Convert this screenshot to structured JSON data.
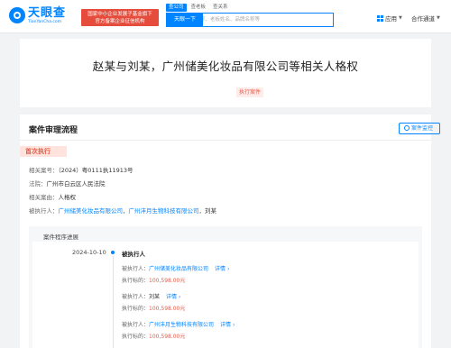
{
  "header": {
    "logo_name": "天眼查",
    "logo_domain": "TianYanCha.com",
    "banner_line1": "国家中小企业发展子基金旗下",
    "banner_line2": "官方备案企业征信机构",
    "search_tabs": [
      "查公司",
      "查老板",
      "查关系"
    ],
    "search_placeholder": "请输入公司名称、老板姓名、品牌名称等",
    "search_button": "天眼一下",
    "nav_app": "应用",
    "nav_cooperation": "合作通道"
  },
  "title_card": {
    "title": "赵某与刘某，广州储美化妆品有限公司等相关人格权",
    "status_tag": "执行案件"
  },
  "main": {
    "section_title": "案件审理流程",
    "monitor_button": "案件监控",
    "stage_tag": "首次执行",
    "fields": [
      {
        "label": "相关案号：",
        "value": "（2024）粤0111执11913号"
      },
      {
        "label": "法院：",
        "value": "广州市白云区人民法院"
      },
      {
        "label": "相关案由：",
        "value": "人格权"
      }
    ],
    "executed_label": "被执行人：",
    "executed_links": [
      "广州储美化妆品有限公司",
      "广州沣月生物科技有限公司"
    ],
    "executed_plain": "刘某",
    "sub_panel": {
      "title": "案件程序进展",
      "date": "2024-10-10",
      "event": "被执行人",
      "entries": [
        {
          "label": "被执行人：",
          "name": "广州储美化妆品有限公司",
          "is_link": true,
          "detail": "详情",
          "amount_label": "执行标的：",
          "amount": "100,598.00元"
        },
        {
          "label": "被执行人：",
          "name": "刘某",
          "is_link": false,
          "detail": "详情",
          "amount_label": "执行标的：",
          "amount": "100,598.00元"
        },
        {
          "label": "被执行人：",
          "name": "广州沣月生物科技有限公司",
          "is_link": true,
          "detail": "详情",
          "amount_label": "执行标的：",
          "amount": "100,598.00元"
        }
      ]
    }
  },
  "colors": {
    "accent": "#0084ff",
    "status_red": "#e55d4a",
    "banner_red": "#e64c3c"
  }
}
